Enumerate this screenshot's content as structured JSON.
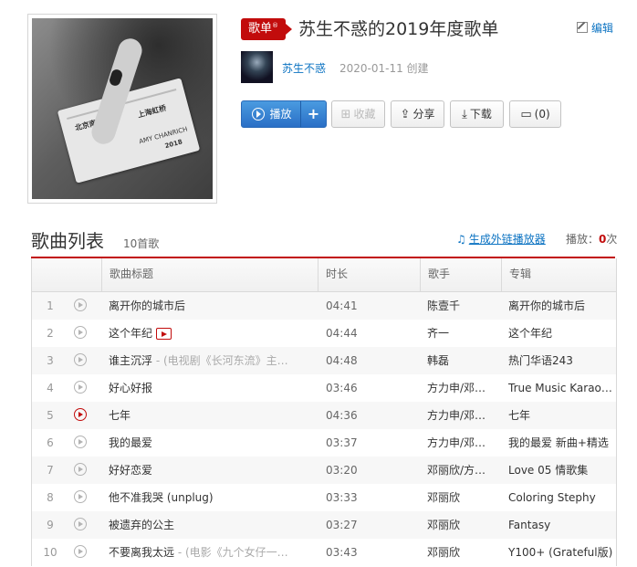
{
  "playlist": {
    "badge": "歌单",
    "badge_mark": "®",
    "title": "苏生不惑的2019年度歌单",
    "edit_label": "编辑",
    "author": "苏生不惑",
    "created": "2020-01-11 创建"
  },
  "cover_text": {
    "from": "北京南",
    "to": "上海虹桥",
    "name": "AMY CHANRICH",
    "year": "2018"
  },
  "actions": {
    "play": "播放",
    "add": "+",
    "collect": "收藏",
    "share": "分享",
    "download": "下载",
    "comment": "(0)"
  },
  "list": {
    "title": "歌曲列表",
    "count": "10首歌",
    "gen_link": "生成外链播放器",
    "plays_label": "播放：",
    "plays_value": "0",
    "plays_unit": "次",
    "columns": [
      "歌曲标题",
      "时长",
      "歌手",
      "专辑"
    ]
  },
  "songs": [
    {
      "num": "1",
      "title": "离开你的城市后",
      "sub": "",
      "dur": "04:41",
      "artist": "陈壹千",
      "album": "离开你的城市后"
    },
    {
      "num": "2",
      "title": "这个年纪",
      "sub": "",
      "dur": "04:44",
      "artist": "齐一",
      "album": "这个年纪"
    },
    {
      "num": "3",
      "title": "谁主沉浮",
      "sub": " - (电视剧《长河东流》主…",
      "dur": "04:48",
      "artist": "韩磊",
      "album": "热门华语243"
    },
    {
      "num": "4",
      "title": "好心好报",
      "sub": "",
      "dur": "03:46",
      "artist": "方力申/邓…",
      "album": "True Music Karao…"
    },
    {
      "num": "5",
      "title": "七年",
      "sub": "",
      "dur": "04:36",
      "artist": "方力申/邓…",
      "album": "七年"
    },
    {
      "num": "6",
      "title": "我的最爱",
      "sub": "",
      "dur": "03:37",
      "artist": "方力申/邓…",
      "album": "我的最爱 新曲+精选"
    },
    {
      "num": "7",
      "title": "好好恋爱",
      "sub": "",
      "dur": "03:20",
      "artist": "邓丽欣/方…",
      "album": "Love 05 情歌集"
    },
    {
      "num": "8",
      "title": "他不准我哭 (unplug)",
      "sub": "",
      "dur": "03:33",
      "artist": "邓丽欣",
      "album": "Coloring Stephy"
    },
    {
      "num": "9",
      "title": "被遗弃的公主",
      "sub": "",
      "dur": "03:27",
      "artist": "邓丽欣",
      "album": "Fantasy"
    },
    {
      "num": "10",
      "title": "不要离我太远",
      "sub": " - (电影《九个女仔一…",
      "dur": "03:43",
      "artist": "邓丽欣",
      "album": "Y100+ (Grateful版)"
    }
  ]
}
